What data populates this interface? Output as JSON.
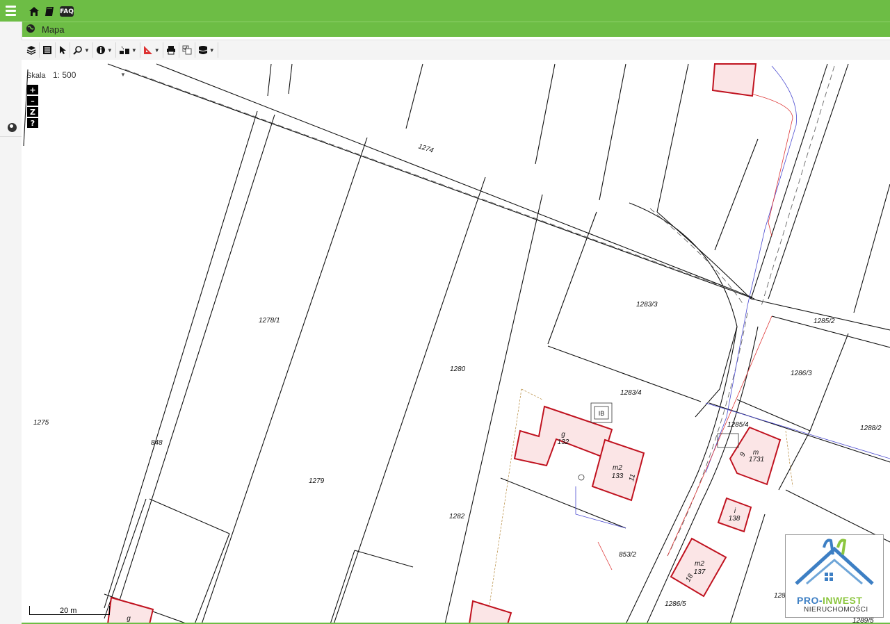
{
  "app": {
    "title": "Mapa",
    "top_icons": [
      "home-icon",
      "book-icon",
      "faq-icon"
    ],
    "faq_label": "FAQ",
    "accent_color": "#6dbd45"
  },
  "toolbar": {
    "tools": [
      {
        "name": "layers-icon",
        "caret": false
      },
      {
        "name": "list-icon",
        "caret": false
      },
      {
        "name": "pointer-icon",
        "caret": false
      },
      {
        "name": "zoom-icon",
        "caret": true
      },
      {
        "name": "info-icon",
        "caret": true
      },
      {
        "name": "select-area-icon",
        "caret": true
      },
      {
        "name": "measure-icon",
        "caret": true
      },
      {
        "name": "print-icon",
        "caret": false
      },
      {
        "name": "compare-icon",
        "caret": false
      },
      {
        "name": "database-icon",
        "caret": true
      }
    ]
  },
  "map": {
    "scale_label": "Skala",
    "scale_value": "1: 500",
    "scalebar_label": "20 m",
    "zoom": {
      "plus": "+",
      "minus": "–",
      "zoom_z": "Z",
      "help": "?"
    },
    "parcels": [
      "1274",
      "1275",
      "1278/1",
      "1279",
      "1280",
      "1282",
      "1283/3",
      "1283/4",
      "1285/2",
      "1286/3",
      "1288/2",
      "1285/4",
      "1286/5",
      "1286/3",
      "1289/5",
      "853/2",
      "848"
    ],
    "buildings": [
      {
        "type": "g",
        "number": "132"
      },
      {
        "type": "m2",
        "number": "133",
        "house_no": "11"
      },
      {
        "type": "m",
        "number": "1731",
        "house_no": "9"
      },
      {
        "type": "i",
        "number": "138"
      },
      {
        "type": "m2",
        "number": "137",
        "house_no": "18"
      },
      {
        "type": "g",
        "number": ""
      }
    ],
    "misc_labels": [
      "IB"
    ]
  },
  "logo": {
    "text_pro": "PRO-",
    "text_inwest": "INWEST",
    "text_sub": "NIERUCHOMOŚCI"
  }
}
